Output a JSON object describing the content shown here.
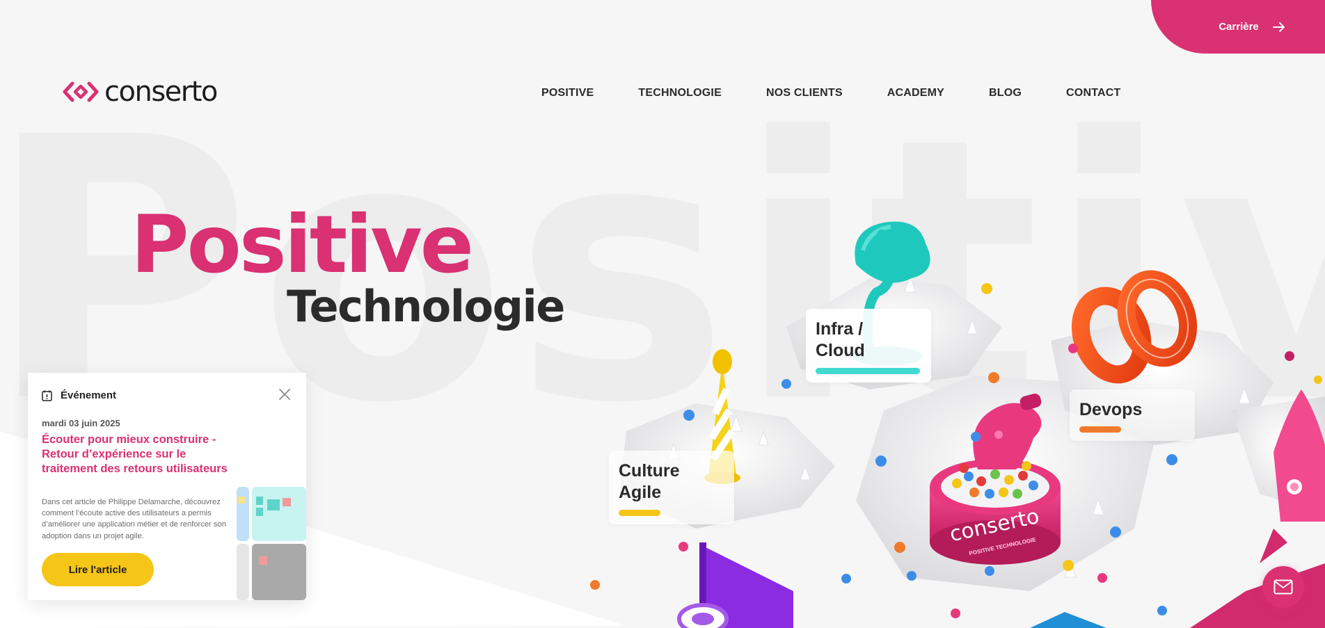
{
  "background_word": "Positive",
  "career": {
    "label": "Carrière",
    "icon": "arrow-right-icon"
  },
  "logo": {
    "text": "conserto",
    "icon": "code-brackets-icon"
  },
  "nav": [
    {
      "label": "POSITIVE"
    },
    {
      "label": "TECHNOLOGIE"
    },
    {
      "label": "NOS CLIENTS"
    },
    {
      "label": "ACADEMY"
    },
    {
      "label": "BLOG"
    },
    {
      "label": "CONTACT"
    }
  ],
  "hero": {
    "title": "Positive",
    "subtitle": "Technologie"
  },
  "scene": {
    "labels": [
      {
        "text_line1": "Infra /",
        "text_line2": "Cloud",
        "bar_color": "#3fd9d0"
      },
      {
        "text_line1": "Devops",
        "bar_color": "#f07a2c"
      },
      {
        "text_line1": "Culture",
        "text_line2": "Agile",
        "bar_color": "#f5c518"
      }
    ],
    "pedestal_text": "conserto",
    "pedestal_subtext": "POSITIVE TECHNOLOGIE"
  },
  "event": {
    "category": "Événement",
    "date": "mardi 03 juin 2025",
    "title": "Écouter pour mieux construire - Retour d’expérience sur le traitement des retours utilisateurs",
    "description": "Dans cet article de Philippe Delamarche, découvrez comment l’écoute active des utilisateurs a permis d’améliorer une application métier et de renforcer son adoption dans un projet agile.",
    "button": "Lire l'article"
  },
  "colors": {
    "brand_pink": "#d93172",
    "yellow": "#f5c518",
    "teal": "#3fd9d0",
    "orange": "#f07a2c"
  }
}
